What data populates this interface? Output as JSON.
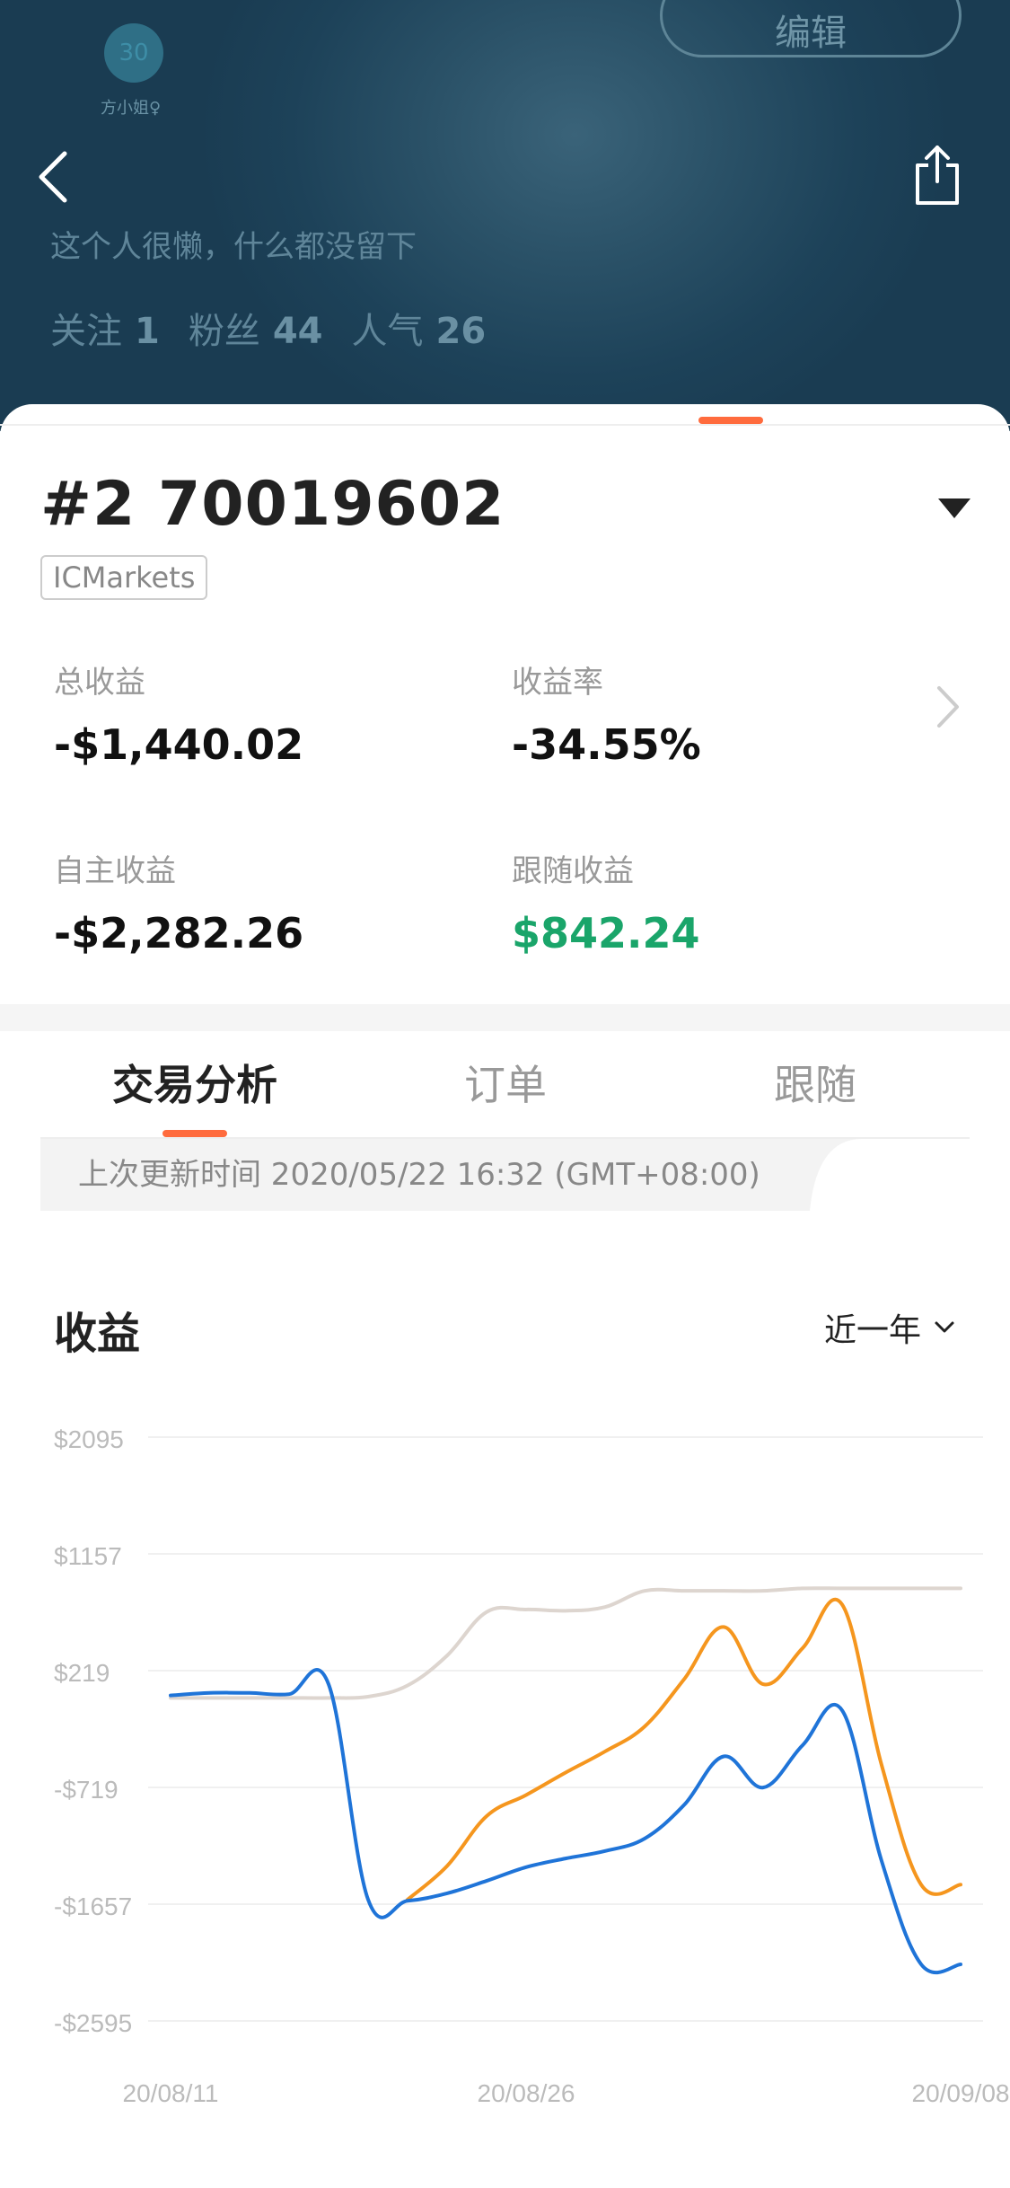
{
  "header": {
    "avatar_text": "30",
    "nickname": "方小姐♀",
    "edit_label": "编辑",
    "bio": "这个人很懒，什么都没留下",
    "stats": [
      {
        "label": "关注",
        "value": "1"
      },
      {
        "label": "粉丝",
        "value": "44"
      },
      {
        "label": "人气",
        "value": "26"
      }
    ],
    "icons": {
      "back": "chevron-left-icon",
      "share": "share-icon"
    }
  },
  "account": {
    "title": "#2 70019602",
    "broker": "ICMarkets",
    "metrics": {
      "total_profit": {
        "label": "总收益",
        "value": "-$1,440.02"
      },
      "return_rate": {
        "label": "收益率",
        "value": "-34.55%"
      },
      "own_profit": {
        "label": "自主收益",
        "value": "-$2,282.26"
      },
      "follow_profit": {
        "label": "跟随收益",
        "value": "$842.24"
      }
    }
  },
  "tabs": [
    {
      "label": "交易分析",
      "active": true
    },
    {
      "label": "订单",
      "active": false
    },
    {
      "label": "跟随",
      "active": false
    }
  ],
  "update_text": "上次更新时间 2020/05/22 16:32 (GMT+08:00)",
  "profit_section": {
    "title": "收益",
    "period": "近一年"
  },
  "colors": {
    "accent": "#ff6b3d",
    "positive": "#1aa56a",
    "series_blue": "#1f74d8",
    "series_orange": "#f5961e",
    "series_gray": "#ddd5cf"
  },
  "chart_data": {
    "type": "line",
    "ylim": [
      -2595,
      2095
    ],
    "y_ticks": [
      "$2095",
      "$1157",
      "$219",
      "-$719",
      "-$1657",
      "-$2595"
    ],
    "y_tick_values": [
      2095,
      1157,
      219,
      -719,
      -1657,
      -2595
    ],
    "x_ticks": [
      "20/08/11",
      "20/08/26",
      "20/09/08"
    ],
    "grid": true,
    "x": [
      "20/08/11",
      "20/08/13",
      "20/08/15",
      "20/08/17",
      "20/08/19",
      "20/08/20",
      "20/08/21",
      "20/08/23",
      "20/08/25",
      "20/08/26",
      "20/08/27",
      "20/08/29",
      "20/08/31",
      "20/09/01",
      "20/09/02",
      "20/09/03",
      "20/09/04",
      "20/09/05",
      "20/09/06",
      "20/09/07",
      "20/09/08"
    ],
    "series": [
      {
        "color": "#ddd5cf",
        "values": [
          0,
          0,
          0,
          0,
          0,
          10,
          100,
          340,
          690,
          710,
          700,
          730,
          860,
          860,
          860,
          860,
          880,
          880,
          880,
          880,
          880
        ]
      },
      {
        "color": "#f5961e",
        "values": [
          null,
          null,
          null,
          null,
          null,
          null,
          -1620,
          -1350,
          -950,
          -780,
          -600,
          -430,
          -230,
          150,
          570,
          110,
          400,
          750,
          -540,
          -1500,
          -1500
        ]
      },
      {
        "color": "#1f74d8",
        "values": [
          20,
          40,
          40,
          30,
          110,
          -1620,
          -1630,
          -1570,
          -1470,
          -1360,
          -1290,
          -1230,
          -1130,
          -860,
          -470,
          -720,
          -380,
          -100,
          -1310,
          -2140,
          -2140
        ]
      }
    ]
  }
}
